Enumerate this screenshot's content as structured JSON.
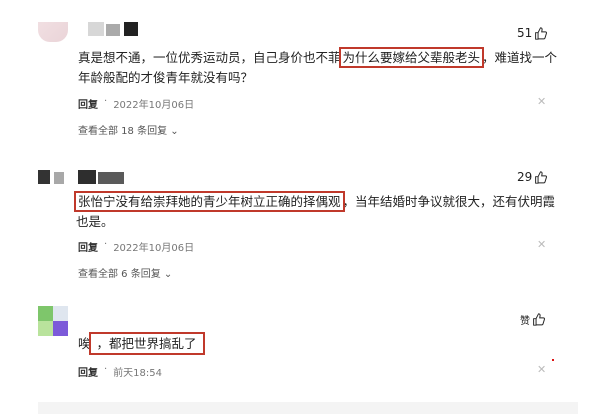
{
  "comments": [
    {
      "like_count": "51",
      "text_before": "真是想不通，一位优秀运动员，自己身价也不菲",
      "highlight": "为什么要嫁给父辈般老头",
      "text_after": "，难道找一个年龄般配的才俊青年就没有吗？",
      "reply_label": "回复",
      "date": "2022年10月06日",
      "view_replies": "查看全部 18 条回复"
    },
    {
      "like_count": "29",
      "highlight": "张怡宁没有给崇拜她的青少年树立正确的择偶观",
      "text_after": "，当年结婚时争议就很大，还有伏明霞也是。",
      "reply_label": "回复",
      "date": "2022年10月06日",
      "view_replies": "查看全部 6 条回复"
    },
    {
      "like_count": "赞",
      "text_before": "唉",
      "highlight": "，都把世界搞乱了",
      "reply_label": "回复",
      "date": "前天18:54"
    }
  ],
  "colors": {
    "highlight_box": "#c0392b",
    "meta_text": "#777777",
    "footer_bar": "#f4f4f4"
  },
  "icons": {
    "like": "thumbs-up-icon",
    "close": "close-icon",
    "expand": "chevron-down-icon"
  }
}
